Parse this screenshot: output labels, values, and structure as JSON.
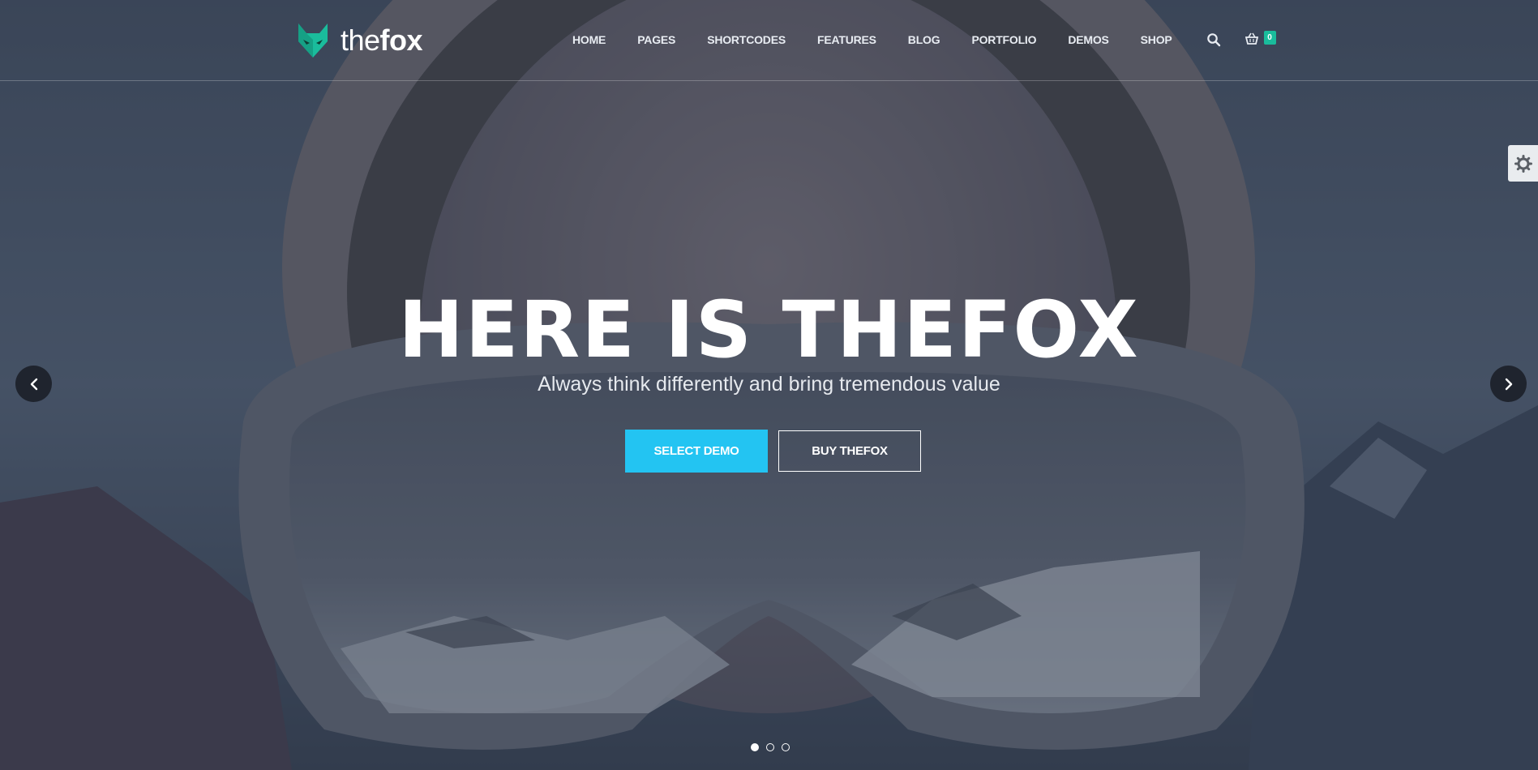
{
  "brand": {
    "name_light": "the",
    "name_bold": "fox",
    "accent_color": "#1abc9c"
  },
  "nav": {
    "items": [
      "HOME",
      "PAGES",
      "SHORTCODES",
      "FEATURES",
      "BLOG",
      "PORTFOLIO",
      "DEMOS",
      "SHOP"
    ],
    "search_icon": "search-icon",
    "cart_icon": "basket-icon",
    "cart_count": "0"
  },
  "slide": {
    "title": "HERE IS THEFOX",
    "subtitle": "Always think differently and bring tremendous value",
    "primary_button": "SELECT DEMO",
    "secondary_button": "BUY THEFOX",
    "primary_color": "#23c4f2",
    "total_slides": 3,
    "active_slide": 1
  },
  "controls": {
    "prev_icon": "chevron-left-icon",
    "next_icon": "chevron-right-icon",
    "settings_icon": "gear-icon"
  }
}
